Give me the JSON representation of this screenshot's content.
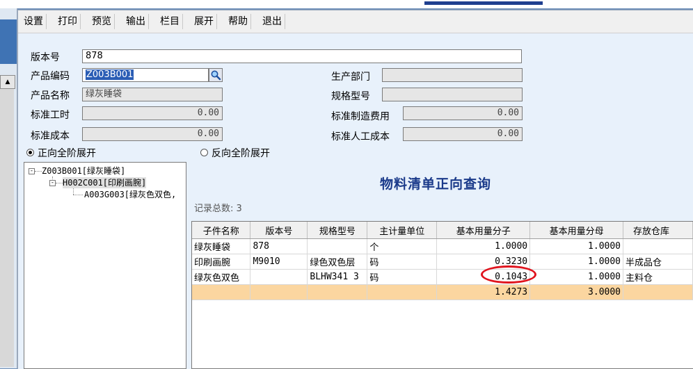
{
  "toolbar": {
    "buttons": [
      "设置",
      "打印",
      "预览",
      "输出",
      "栏目",
      "展开",
      "帮助",
      "退出"
    ]
  },
  "form": {
    "version_label": "版本号",
    "version_value": "878",
    "product_code_label": "产品编码",
    "product_code_value": "Z003B001",
    "product_name_label": "产品名称",
    "product_name_value": "绿灰睡袋",
    "std_hours_label": "标准工时",
    "std_hours_value": "0.00",
    "std_cost_label": "标准成本",
    "std_cost_value": "0.00",
    "dept_label": "生产部门",
    "dept_value": "",
    "spec_label": "规格型号",
    "spec_value": "",
    "mfg_fee_label": "标准制造费用",
    "mfg_fee_value": "0.00",
    "labor_label": "标准人工成本",
    "labor_value": "0.00",
    "radio_forward": "正向全阶展开",
    "radio_reverse": "反向全阶展开"
  },
  "tree": {
    "root": "Z003B001[绿灰睡袋]",
    "child": "H002C001[印刷画腕]",
    "leaf": "A003G003[绿灰色双色,"
  },
  "page_title": "物料清单正向查询",
  "record_count": "记录总数: 3",
  "grid": {
    "headers": [
      "子件名称",
      "版本号",
      "规格型号",
      "主计量单位",
      "基本用量分子",
      "基本用量分母",
      "存放仓库"
    ],
    "rows": [
      [
        "绿灰睡袋",
        "878",
        "",
        "个",
        "1.0000",
        "1.0000",
        ""
      ],
      [
        "印刷画腕",
        "M9010",
        "绿色双色层",
        "码",
        "0.3230",
        "1.0000",
        "半成品仓"
      ],
      [
        "绿灰色双色",
        "",
        "BLHW341 3",
        "码",
        "0.1043",
        "1.0000",
        "主料仓"
      ]
    ],
    "total": [
      "",
      "",
      "",
      "",
      "1.4273",
      "3.0000",
      ""
    ]
  },
  "colors": {
    "highlight_circle": "#e0141e",
    "total_row": "#fbd6a0",
    "title": "#1a3a8a"
  }
}
